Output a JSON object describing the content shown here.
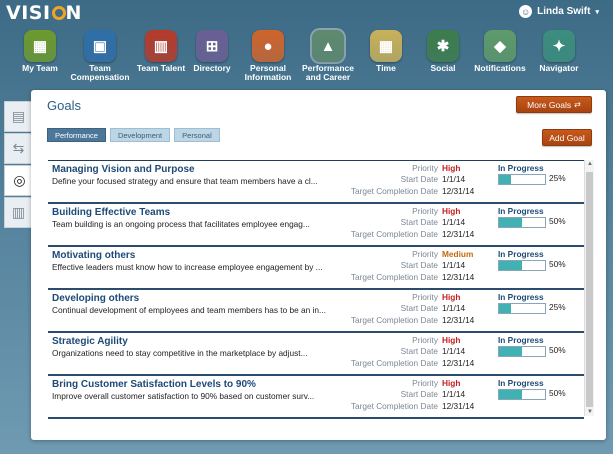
{
  "app": {
    "logo_text": "VISI",
    "logo_text_end": "N"
  },
  "user": {
    "name": "Linda Swift",
    "menu_caret": "▾"
  },
  "nav": [
    {
      "label": "My Team",
      "icon": "team-icon",
      "color": "#6d9a2d"
    },
    {
      "label": "Team Compensation",
      "icon": "compensation-icon",
      "color": "#2f6ea8"
    },
    {
      "label": "Team Talent",
      "icon": "talent-icon",
      "color": "#b63a2a"
    },
    {
      "label": "Directory",
      "icon": "directory-icon",
      "color": "#6a5f94"
    },
    {
      "label": "Personal Information",
      "icon": "person-icon",
      "color": "#d0642c"
    },
    {
      "label": "Performance and Career",
      "icon": "career-icon",
      "color": "#5f8a6e",
      "active": true
    },
    {
      "label": "Time",
      "icon": "calendar-icon",
      "color": "#c9b15a"
    },
    {
      "label": "Social",
      "icon": "social-icon",
      "color": "#3d7d4c"
    },
    {
      "label": "Notifications",
      "icon": "bell-icon",
      "color": "#5e9a6a"
    },
    {
      "label": "Navigator",
      "icon": "compass-icon",
      "color": "#3b8e7d"
    }
  ],
  "sidetabs": [
    {
      "icon": "presentation-icon",
      "glyph": "▤"
    },
    {
      "icon": "signpost-icon",
      "glyph": "⇆"
    },
    {
      "icon": "target-icon",
      "glyph": "◎",
      "active": true
    },
    {
      "icon": "bar-chart-icon",
      "glyph": "▥"
    }
  ],
  "panel": {
    "title": "Goals",
    "more_goals_label": "More Goals",
    "add_goal_label": "Add Goal",
    "tabs": [
      {
        "label": "Performance",
        "active": true
      },
      {
        "label": "Development"
      },
      {
        "label": "Personal"
      }
    ],
    "labels": {
      "priority": "Priority",
      "start": "Start Date",
      "target": "Target Completion Date"
    }
  },
  "goals": [
    {
      "title": "Managing Vision and Purpose",
      "desc": "Define your focused strategy and ensure that team members have a cl...",
      "priority": "High",
      "start": "1/1/14",
      "target": "12/31/14",
      "status": "In Progress",
      "progress": 25,
      "progress_label": "25%"
    },
    {
      "title": "Building Effective Teams",
      "desc": "Team building is an ongoing process that facilitates employee engag...",
      "priority": "High",
      "start": "1/1/14",
      "target": "12/31/14",
      "status": "In Progress",
      "progress": 50,
      "progress_label": "50%"
    },
    {
      "title": "Motivating others",
      "desc": "Effective leaders must know how to increase employee engagement by ...",
      "priority": "Medium",
      "start": "1/1/14",
      "target": "12/31/14",
      "status": "In Progress",
      "progress": 50,
      "progress_label": "50%"
    },
    {
      "title": "Developing others",
      "desc": "Continual development of employees and team members has to be an in...",
      "priority": "High",
      "start": "1/1/14",
      "target": "12/31/14",
      "status": "In Progress",
      "progress": 25,
      "progress_label": "25%"
    },
    {
      "title": "Strategic Agility",
      "desc": "Organizations need to stay competitive in the marketplace by adjust...",
      "priority": "High",
      "start": "1/1/14",
      "target": "12/31/14",
      "status": "In Progress",
      "progress": 50,
      "progress_label": "50%"
    },
    {
      "title": "Bring Customer Satisfaction Levels to 90%",
      "desc": "Improve overall customer satisfaction to 90% based on customer surv...",
      "priority": "High",
      "start": "1/1/14",
      "target": "12/31/14",
      "status": "In Progress",
      "progress": 50,
      "progress_label": "50%"
    }
  ]
}
